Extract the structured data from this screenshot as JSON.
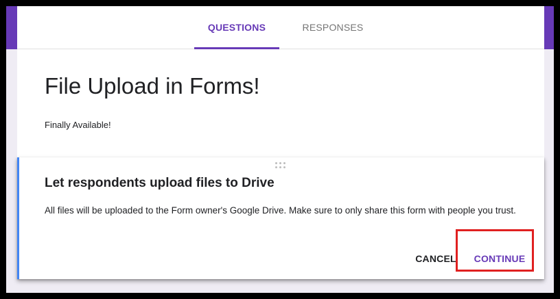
{
  "tabs": [
    {
      "label": "QUESTIONS",
      "active": true
    },
    {
      "label": "RESPONSES",
      "active": false
    }
  ],
  "form": {
    "title": "File Upload in Forms!",
    "description": "Finally Available!"
  },
  "dialog": {
    "title": "Let respondents upload files to Drive",
    "body": "All files will be uploaded to the Form owner's Google Drive. Make sure to only share this form with people you trust.",
    "cancel_label": "CANCEL",
    "continue_label": "CONTINUE"
  },
  "icons": {
    "drag_handle": "drag-handle-icon"
  },
  "colors": {
    "brand_purple": "#673ab7",
    "accent_blue": "#4285f4",
    "highlight_red": "#e02020",
    "background": "#efecf4"
  }
}
